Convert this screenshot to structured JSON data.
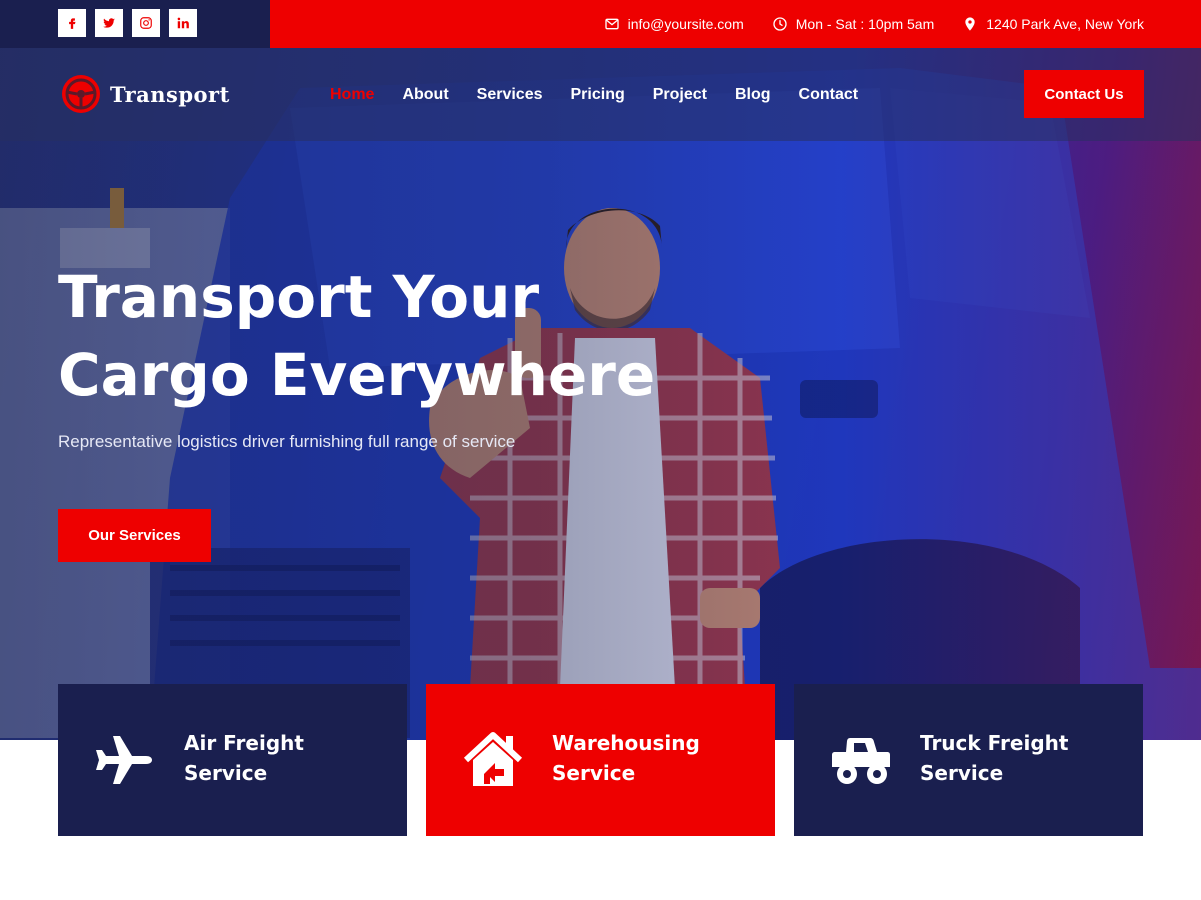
{
  "topbar": {
    "socials": [
      {
        "icon": "facebook-icon"
      },
      {
        "icon": "twitter-icon"
      },
      {
        "icon": "instagram-icon"
      },
      {
        "icon": "linkedin-icon"
      }
    ],
    "email": "info@yoursite.com",
    "hours": "Mon - Sat : 10pm 5am",
    "address": "1240 Park Ave, New York"
  },
  "nav": {
    "logo_text": "Transport",
    "items": [
      "Home",
      "About",
      "Services",
      "Pricing",
      "Project",
      "Blog",
      "Contact"
    ],
    "active_index": 0,
    "cta_label": "Contact Us"
  },
  "hero": {
    "title_line1": "Transport Your",
    "title_line2": "Cargo Everywhere",
    "subtitle": "Representative logistics driver furnishing full range of service",
    "button_label": "Our Services"
  },
  "services": [
    {
      "line1": "Air Freight",
      "line2": "Service",
      "icon": "airplane-icon"
    },
    {
      "line1": "Warehousing",
      "line2": "Service",
      "icon": "warehouse-icon"
    },
    {
      "line1": "Truck Freight",
      "line2": "Service",
      "icon": "truck-icon"
    }
  ],
  "colors": {
    "accent": "#ee0000",
    "navy": "#1a1f4f",
    "white": "#ffffff"
  }
}
